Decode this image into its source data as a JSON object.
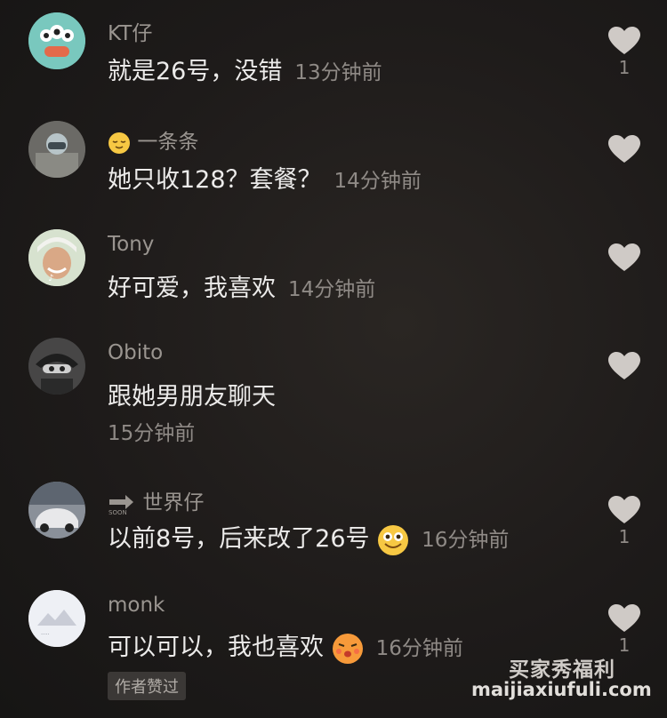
{
  "comments": [
    {
      "user": "KT仔",
      "text": "就是26号，没错",
      "time": "13分钟前",
      "likes": "1"
    },
    {
      "user": "一条条",
      "text": "她只收128？套餐？",
      "time": "14分钟前",
      "likes": ""
    },
    {
      "user": "Tony",
      "text": "好可爱，我喜欢",
      "time": "14分钟前",
      "likes": ""
    },
    {
      "user": "Obito",
      "text": "跟她男朋友聊天",
      "time": "15分钟前",
      "likes": ""
    },
    {
      "user": "世界仔",
      "text": "以前8号，后来改了26号",
      "time": "16分钟前",
      "likes": "1"
    },
    {
      "user": "monk",
      "text": "可以可以，我也喜欢",
      "time": "16分钟前",
      "likes": "1"
    }
  ],
  "author_liked_badge": "作者赞过",
  "watermark": {
    "line1": "买家秀福利",
    "line2": "maijiaxiufuli.com"
  },
  "icons": {
    "like": "heart-icon",
    "emoji_user2": "relieved-face-icon",
    "emoji_user5_prefix": "arrow-soon-icon",
    "emoji_comment5": "grinning-face-icon",
    "emoji_comment6": "kissing-face-icon"
  },
  "colors": {
    "background": "#1c1a19",
    "username": "#9a9590",
    "text": "#ecebea",
    "time": "#8f8a86",
    "heart": "#cfcac6"
  }
}
